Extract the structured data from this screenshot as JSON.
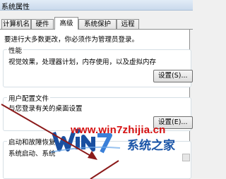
{
  "window": {
    "title": "系统属性"
  },
  "tabs": [
    {
      "label": "计算机名",
      "active": false
    },
    {
      "label": "硬件",
      "active": false
    },
    {
      "label": "高级",
      "active": true
    },
    {
      "label": "系统保护",
      "active": false
    },
    {
      "label": "远程",
      "active": false
    }
  ],
  "admin_notice": "要进行大多数更改，你必须作为管理员登录。",
  "performance": {
    "title": "性能",
    "description": "视觉效果，处理器计划，内存使用，以及虚拟内存",
    "settings_button": "设置(S)..."
  },
  "user_profiles": {
    "title": "用户配置文件",
    "description": "与您登录有关的桌面设置",
    "settings_button": "设置(E)..."
  },
  "startup_recovery": {
    "title": "启动和故障恢复",
    "description": "系统启动、系统"
  },
  "watermark": {
    "url": "www.win7zhijia.cn",
    "name": "系统之家"
  },
  "colors": {
    "arrow": "#8b1a1a",
    "watermark_url": "#d61010",
    "watermark_name": "#1a55a8"
  }
}
